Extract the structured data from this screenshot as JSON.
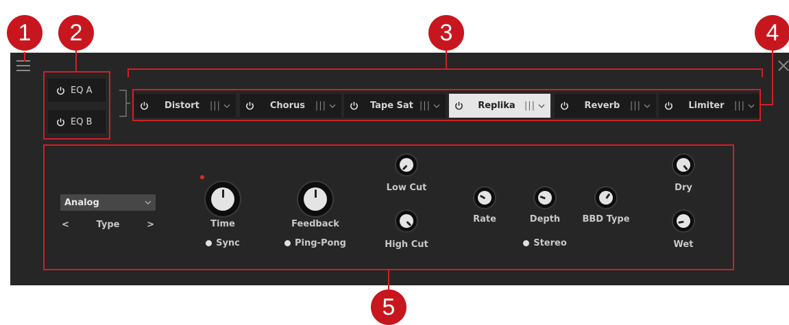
{
  "callouts": [
    "1",
    "2",
    "3",
    "4",
    "5"
  ],
  "eq": {
    "a_label": "EQ A",
    "b_label": "EQ B"
  },
  "chain": [
    {
      "label": "Distort",
      "active": false
    },
    {
      "label": "Chorus",
      "active": false
    },
    {
      "label": "Tape Sat",
      "active": false
    },
    {
      "label": "Replika",
      "active": true
    },
    {
      "label": "Reverb",
      "active": false
    },
    {
      "label": "Limiter",
      "active": false
    }
  ],
  "type_select": {
    "value": "Analog",
    "type_label": "Type",
    "prev": "<",
    "next": ">"
  },
  "controls": {
    "time": "Time",
    "sync": "Sync",
    "feedback": "Feedback",
    "ping_pong": "Ping-Pong",
    "low_cut": "Low Cut",
    "high_cut": "High Cut",
    "rate": "Rate",
    "depth": "Depth",
    "bbd_type": "BBD Type",
    "stereo": "Stereo",
    "dry": "Dry",
    "wet": "Wet"
  },
  "colors": {
    "accent_red": "#d21f26",
    "panel": "#262626"
  },
  "icons": {
    "menu": "hamburger-icon",
    "close": "close-icon",
    "power": "power-icon"
  }
}
